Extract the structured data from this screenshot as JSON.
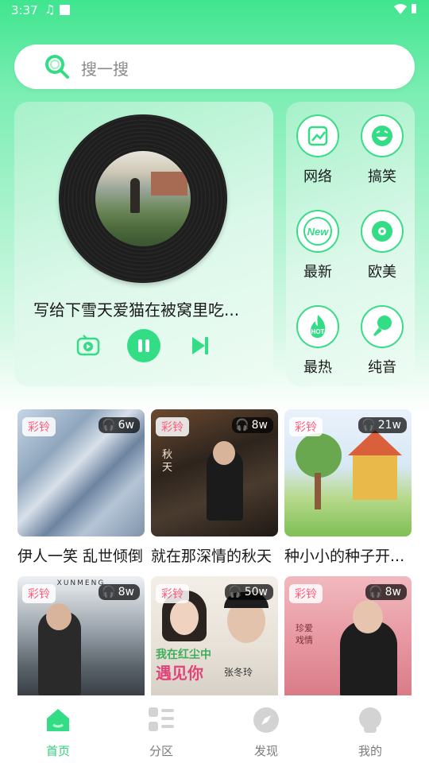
{
  "status_bar": {
    "time": "3:37",
    "note_glyph": "♫"
  },
  "search": {
    "placeholder": "搜一搜"
  },
  "player": {
    "track_title": "写给下雪天爱猫在被窝里吃..."
  },
  "categories": [
    {
      "label": "网络",
      "icon": "trend-chart-icon"
    },
    {
      "label": "搞笑",
      "icon": "laughing-face-icon"
    },
    {
      "label": "最新",
      "icon": "new-badge-icon"
    },
    {
      "label": "欧美",
      "icon": "disc-icon"
    },
    {
      "label": "最热",
      "icon": "hot-flame-icon"
    },
    {
      "label": "纯音",
      "icon": "microphone-icon"
    }
  ],
  "new_badge_text": "New",
  "hot_badge_text": "HOT",
  "songs": [
    {
      "tag": "彩铃",
      "plays": "6w",
      "name": "伊人一笑 乱世倾倒"
    },
    {
      "tag": "彩铃",
      "plays": "8w",
      "name": "就在那深情的秋天"
    },
    {
      "tag": "彩铃",
      "plays": "21w",
      "name": "种小小的种子开..."
    },
    {
      "tag": "彩铃",
      "plays": "8w",
      "name": ""
    },
    {
      "tag": "彩铃",
      "plays": "50w",
      "name": ""
    },
    {
      "tag": "彩铃",
      "plays": "8w",
      "name": ""
    }
  ],
  "thumb_texts": {
    "autumn_vertical": "秋 天",
    "xunmeng": "XUNMENG",
    "red_dust_line1": "我在红尘中",
    "red_dust_line2": "遇见你",
    "singer": "张冬玲",
    "love_story": "珍爱 戏情"
  },
  "nav": [
    {
      "label": "首页",
      "active": true
    },
    {
      "label": "分区",
      "active": false
    },
    {
      "label": "发现",
      "active": false
    },
    {
      "label": "我的",
      "active": false
    }
  ],
  "colors": {
    "accent": "#33dd86",
    "tag_text": "#ff5b7a"
  }
}
